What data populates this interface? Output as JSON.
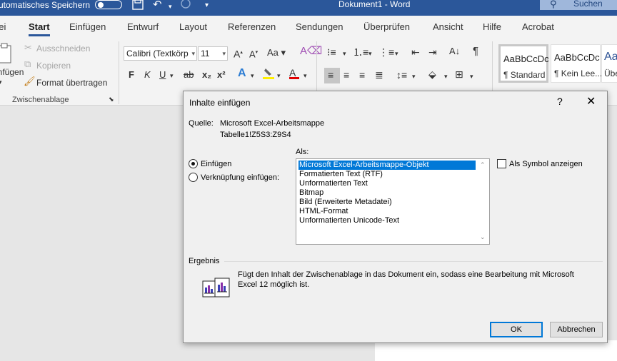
{
  "titlebar": {
    "autosave_label": "Automatisches Speichern",
    "doc_title": "Dokument1  -  Word",
    "search_label": "Suchen",
    "save_icon": "save-icon",
    "undo_icon": "undo-icon",
    "redo_icon": "redo-icon"
  },
  "tabs": [
    {
      "label": "Datei"
    },
    {
      "label": "Start"
    },
    {
      "label": "Einfügen"
    },
    {
      "label": "Entwurf"
    },
    {
      "label": "Layout"
    },
    {
      "label": "Referenzen"
    },
    {
      "label": "Sendungen"
    },
    {
      "label": "Überprüfen"
    },
    {
      "label": "Ansicht"
    },
    {
      "label": "Hilfe"
    },
    {
      "label": "Acrobat"
    }
  ],
  "ribbon": {
    "clipboard": {
      "paste_label": "Einfügen",
      "cut_label": "Ausschneiden",
      "copy_label": "Kopieren",
      "format_painter_label": "Format übertragen",
      "group_label": "Zwischenablage"
    },
    "font": {
      "font_name": "Calibri (Textkörp",
      "font_size": "11",
      "bold": "F",
      "italic": "K",
      "underline": "U",
      "strike": "ab",
      "subscript": "x₂",
      "superscript": "x²"
    },
    "styles": [
      {
        "sample": "AaBbCcDc",
        "name": "¶ Standard"
      },
      {
        "sample": "AaBbCcDc",
        "name": "¶ Kein Lee..."
      },
      {
        "sample": "Aa",
        "name": "Übe"
      }
    ]
  },
  "dialog": {
    "title": "Inhalte einfügen",
    "help": "?",
    "close": "✕",
    "source_label": "Quelle:",
    "source_value": "Microsoft Excel-Arbeitsmappe",
    "source_range": "Tabelle1!Z5S3:Z9S4",
    "als_label": "Als:",
    "radio_paste": "Einfügen",
    "radio_link": "Verknüpfung einfügen:",
    "list_items": [
      "Microsoft Excel-Arbeitsmappe-Objekt",
      "Formatierten Text (RTF)",
      "Unformatierten Text",
      "Bitmap",
      "Bild (Erweiterte Metadatei)",
      "HTML-Format",
      "Unformatierten Unicode-Text"
    ],
    "selected_index": 0,
    "as_symbol_label": "Als Symbol anzeigen",
    "result_label": "Ergebnis",
    "result_text_1": "Fügt den Inhalt der Zwischenablage in das Dokument ein, sodass eine Bearbeitung mit Microsoft",
    "result_text_2": "Excel 12 möglich ist.",
    "ok_label": "OK",
    "cancel_label": "Abbrechen"
  }
}
